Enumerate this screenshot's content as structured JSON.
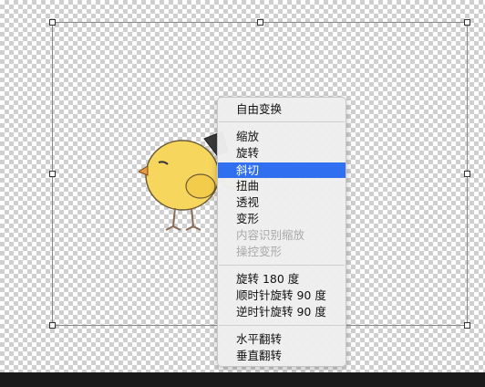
{
  "colors": {
    "menu_highlight": "#2f6ff0",
    "disabled_text": "#a9a9a9",
    "chick_body": "#f7d65e"
  },
  "icons": [
    "chick-image",
    "transform-handle"
  ],
  "menu": {
    "items": [
      {
        "label": "自由变换",
        "state": "normal"
      },
      {
        "label": "缩放",
        "state": "normal"
      },
      {
        "label": "旋转",
        "state": "normal"
      },
      {
        "label": "斜切",
        "state": "selected"
      },
      {
        "label": "扭曲",
        "state": "normal"
      },
      {
        "label": "透视",
        "state": "normal"
      },
      {
        "label": "变形",
        "state": "normal"
      },
      {
        "label": "内容识别缩放",
        "state": "disabled"
      },
      {
        "label": "操控变形",
        "state": "disabled"
      },
      {
        "label": "旋转 180 度",
        "state": "normal"
      },
      {
        "label": "顺时针旋转 90 度",
        "state": "normal"
      },
      {
        "label": "逆时针旋转 90 度",
        "state": "normal"
      },
      {
        "label": "水平翻转",
        "state": "normal"
      },
      {
        "label": "垂直翻转",
        "state": "normal"
      }
    ]
  }
}
